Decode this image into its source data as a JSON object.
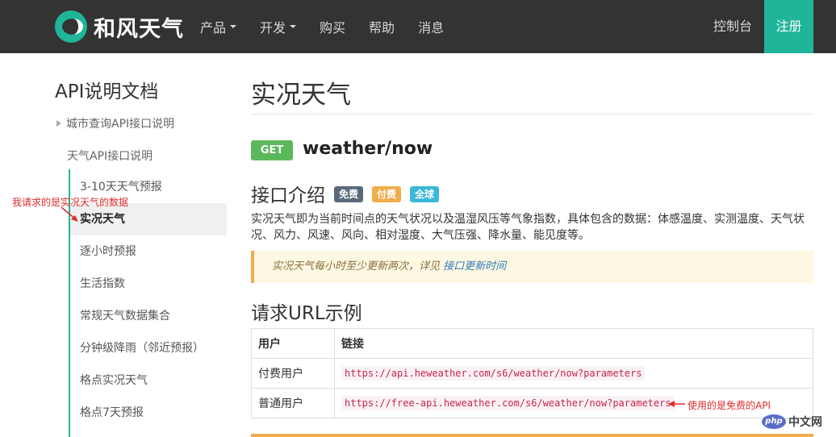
{
  "brand": {
    "name": "和风天气"
  },
  "nav": {
    "items": [
      {
        "label": "产品",
        "dropdown": true
      },
      {
        "label": "开发",
        "dropdown": true
      },
      {
        "label": "购买",
        "dropdown": false
      },
      {
        "label": "帮助",
        "dropdown": false
      },
      {
        "label": "消息",
        "dropdown": false
      }
    ],
    "console": "控制台",
    "register": "注册"
  },
  "sidebar": {
    "title": "API说明文档",
    "city_section": "城市查询API接口说明",
    "weather_section": "天气API接口说明",
    "items": [
      {
        "label": "3-10天天气预报"
      },
      {
        "label": "实况天气",
        "active": true
      },
      {
        "label": "逐小时预报"
      },
      {
        "label": "生活指数"
      },
      {
        "label": "常规天气数据集合"
      },
      {
        "label": "分钟级降雨（邻近预报）"
      },
      {
        "label": "格点实况天气"
      },
      {
        "label": "格点7天预报"
      }
    ],
    "annotation": "我请求的是实况天气的数据"
  },
  "main": {
    "title": "实况天气",
    "method": "GET",
    "endpoint": "weather/now",
    "intro_heading": "接口介绍",
    "tags": [
      {
        "label": "免费",
        "color": "#5a6a7a"
      },
      {
        "label": "付费",
        "color": "#f0ad4e"
      },
      {
        "label": "全球",
        "color": "#3bb8d8"
      }
    ],
    "description": "实况天气即为当前时间点的天气状况以及温湿风压等气象指数，具体包含的数据：体感温度、实测温度、天气状况、风力、风速、风向、相对湿度、大气压强、降水量、能见度等。",
    "note_text": "实况天气每小时至少更新两次，详见",
    "note_link": "接口更新时间",
    "url_heading": "请求URL示例",
    "table": {
      "headers": [
        "用户",
        "链接"
      ],
      "rows": [
        {
          "user": "付费用户",
          "url": "https://api.heweather.com/s6/weather/now?parameters"
        },
        {
          "user": "普通用户",
          "url": "https://free-api.heweather.com/s6/weather/now?parameters"
        }
      ]
    },
    "annotation": "使用的是免费的API"
  },
  "watermark": {
    "logo": "php",
    "text": "中文网"
  },
  "colors": {
    "accent": "#20b59a",
    "topbar": "#333333",
    "annotation": "#e02b2b"
  }
}
